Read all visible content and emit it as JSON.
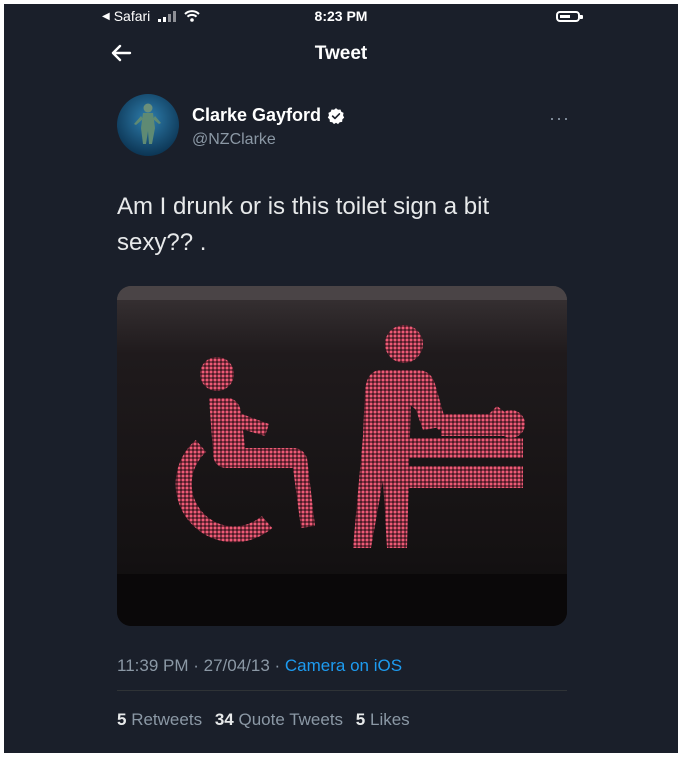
{
  "status_bar": {
    "back_app": "Safari",
    "time": "8:23 PM"
  },
  "nav": {
    "back_icon": "back-arrow-icon",
    "title": "Tweet"
  },
  "tweet": {
    "author_name": "Clarke Gayford",
    "author_handle": "@NZClarke",
    "verified": true,
    "text_line1": "Am I drunk or is this toilet sign a bit",
    "text_line2": "sexy?? .",
    "timestamp": "11:39 PM · 27/04/13 ·",
    "source": "Camera on iOS",
    "more_icon": "more-icon",
    "stats": {
      "retweets_count": "5",
      "retweets_label": "Retweets",
      "quote_count": "34",
      "quote_label": "Quote Tweets",
      "likes_count": "5",
      "likes_label": "Likes"
    }
  },
  "colors": {
    "background": "#1a1f2a",
    "accent": "#1d9bf0",
    "sign_led": "#e8536f"
  }
}
